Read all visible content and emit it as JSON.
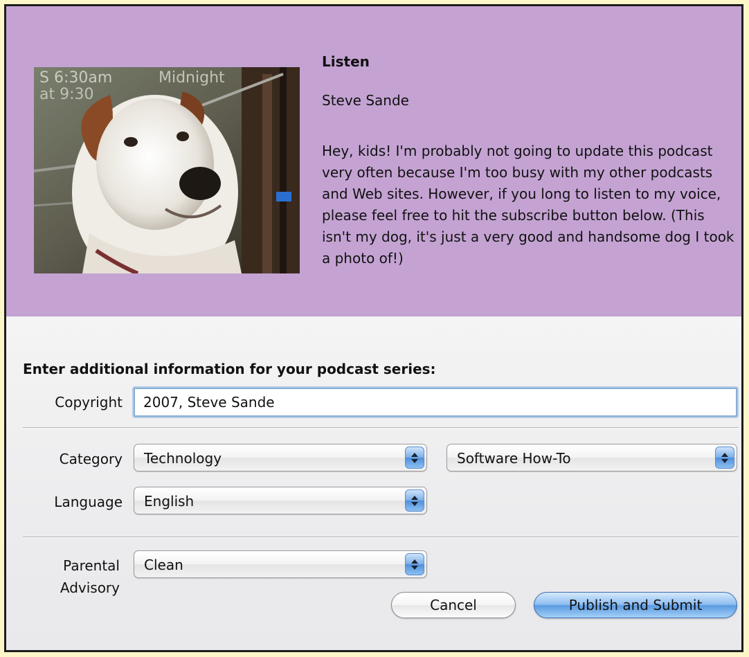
{
  "podcast": {
    "title": "Listen",
    "author": "Steve Sande",
    "description": "Hey, kids! I'm probably not going to update this podcast very often because I'm too busy with my other podcasts and Web sites. However, if you long to listen to my voice, please feel free to hit the subscribe button below. (This isn't my dog, it's just a very good and handsome dog I took a photo of!)",
    "artwork": "dog-photo"
  },
  "form": {
    "instructions": "Enter additional information for your podcast series:",
    "copyright": {
      "label": "Copyright",
      "value": "2007, Steve Sande"
    },
    "category": {
      "label": "Category",
      "value": "Technology",
      "subcategory": "Software How-To"
    },
    "language": {
      "label": "Language",
      "value": "English"
    },
    "parental": {
      "label_line1": "Parental",
      "label_line2": "Advisory",
      "value": "Clean"
    }
  },
  "buttons": {
    "cancel": "Cancel",
    "publish": "Publish and Submit"
  },
  "colors": {
    "header_background": "#c4a3d3",
    "page_background": "#fdf6c8",
    "accent_blue": "#5a9ae2"
  }
}
